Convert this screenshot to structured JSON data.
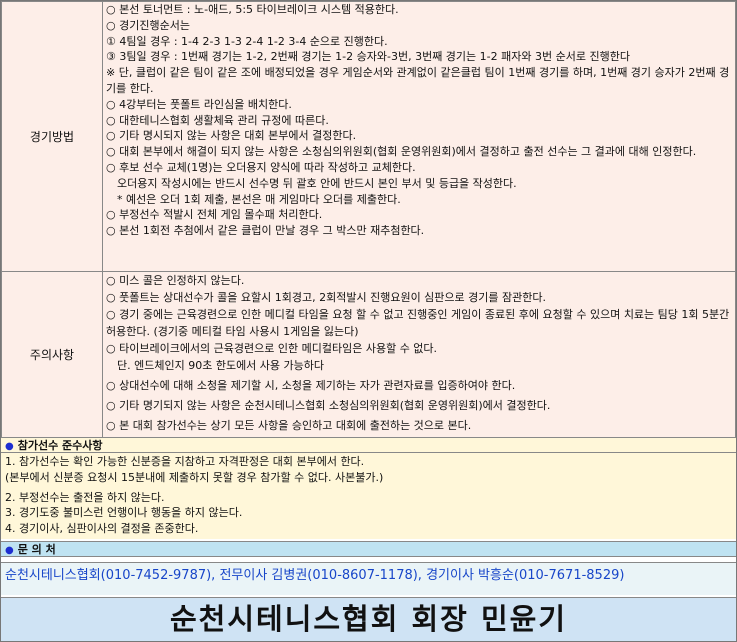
{
  "rules": [
    {
      "category": "경기방법",
      "lines": [
        "○ 본선 토너먼트 : 노-애드, 5:5 타이브레이크 시스템 적용한다.",
        "○ 경기진행순서는",
        "① 4팀일 경우 : 1-4 2-3 1-3 2-4 1-2 3-4 순으로 진행한다.",
        "③ 3팀일 경우 : 1번째 경기는 1-2, 2번째 경기는 1-2 승자와-3번, 3번째 경기는 1-2 패자와 3번 순서로 진행한다",
        "※ 단, 클럽이 같은 팀이 같은 조에 배정되었을 경우 게임순서와 관계없이 같은클럽 팀이 1번째 경기를 하며, 1번째 경기 승자가 2번째 경기를 한다.",
        "○ 4강부터는 풋폴트 라인심을 배치한다.",
        "○ 대한테니스협회 생활체육 관리 규정에 따른다.",
        "○ 기타 명시되지 않는 사항은 대회 본부에서 결정한다.",
        "○ 대회 본부에서 해결이 되지 않는 사항은 소청심의위원회(협회 운영위원회)에서 결정하고 출전 선수는 그 결과에 대해 인정한다.",
        "○ 후보 선수 교체(1명)는 오더용지 양식에 따라 작성하고 교체한다.",
        "　오더용지 작성시에는 반드시 선수명 뒤 괄호 안에 반드시 본인 부서 및 등급을 작성한다.",
        "　* 예선은 오더 1회 제출, 본선은 매 게임마다 오더를 제출한다.",
        "○ 부정선수 적발시 전체 게임 몰수패 처리한다.",
        "○ 본선 1회전 추첨에서 같은 클럽이 만날 경우 그 박스만 재추첨한다."
      ]
    },
    {
      "category": "주의사항",
      "lines": [
        "○ 미스 콜은 인정하지 않는다.",
        "○ 풋폴트는 상대선수가 콜을 요할시 1회경고, 2회적발시 진행요원이 심판으로 경기를 잠관한다.",
        "○ 경기 중에는 근육경련으로 인한 메디컬 타임을 요청 할 수 없고 진행중인 게임이 종료된 후에 요청할 수 있으며 치료는 팀당 1회 5분간 허용한다. (경기중 메티컬 타임 사용시 1게임을 잃는다)",
        "○ 타이브레이크에서의 근육경련으로 인한 메디컬타임은 사용할 수 없다.",
        "　단. 엔드체인지 90초 한도에서 사용 가능하다",
        "○ 상대선수에 대해 소청을 제기할 시, 소청을 제기하는 자가 관련자료를 입증하여야 한다.",
        "○ 기타 명기되지 않는 사항은 순천시테니스협회 소청심의위원회(협회 운영위원회)에서 결정한다.",
        "○ 본 대회 참가선수는 상기 모든 사항을 승인하고 대회에 출전하는 것으로 본다."
      ]
    }
  ],
  "compliance": {
    "title": "참가선수 준수사항",
    "items": [
      "1. 참가선수는 확인 가능한 신분증을 지참하고 자격판정은 대회 본부에서 한다.",
      "(본부에서 신분증 요청시 15분내에 제출하지 못할 경우 참가할 수 없다. 사본불가.)",
      "2. 부정선수는 출전을 하지 않는다.",
      "3. 경기도중 불미스런 언행이나 행동을 하지 않는다.",
      "4. 경기이사, 심판이사의 결정을 존중한다."
    ]
  },
  "inquiry": {
    "title": "문 의 처",
    "contact": "순천시테니스협회(010-7452-9787), 전무이사 김병권(010-8607-1178), 경기이사 박흥순(010-7671-8529)"
  },
  "signature": "순천시테니스협회 회장 민윤기",
  "colors": {
    "rules_bg": "#fdeee8",
    "notice_bg": "#fff7d9",
    "inquiry_head_bg": "#bfe3f2",
    "contact_text": "#1846c9",
    "signature_bg": "#cfe3f4",
    "bullet_dot": "#1e2fd0"
  }
}
